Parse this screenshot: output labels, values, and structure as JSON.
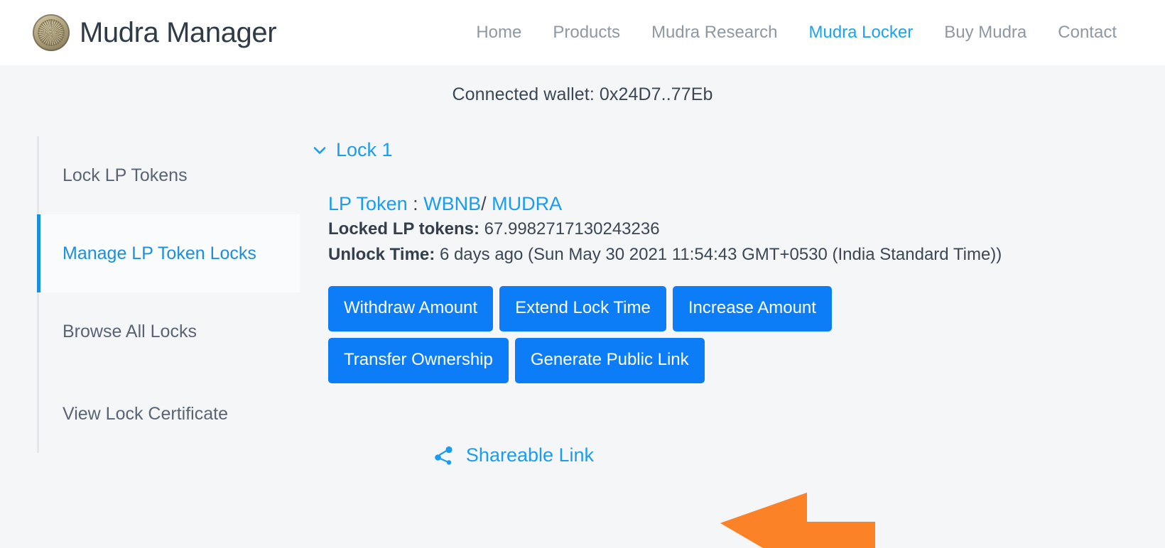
{
  "header": {
    "brand": {
      "logo_icon": "mudra-coin-icon",
      "title": "Mudra Manager"
    },
    "nav": [
      {
        "label": "Home",
        "active": false
      },
      {
        "label": "Products",
        "active": false
      },
      {
        "label": "Mudra Research",
        "active": false
      },
      {
        "label": "Mudra Locker",
        "active": true
      },
      {
        "label": "Buy Mudra",
        "active": false
      },
      {
        "label": "Contact",
        "active": false
      }
    ]
  },
  "wallet": {
    "text": "Connected wallet: 0x24D7..77Eb"
  },
  "sidebar": {
    "items": [
      {
        "label": "Lock LP Tokens",
        "active": false
      },
      {
        "label": "Manage LP Token Locks",
        "active": true
      },
      {
        "label": "Browse All Locks",
        "active": false
      },
      {
        "label": "View Lock Certificate",
        "active": false
      }
    ]
  },
  "lock": {
    "toggle_icon": "chevron-down-icon",
    "toggle_label": "Lock 1",
    "lp_token_label": "LP Token",
    "lp_token_colon": " : ",
    "lp_token_a": "WBNB",
    "lp_token_separator": "/ ",
    "lp_token_b": "MUDRA",
    "locked_label": "Locked LP tokens:",
    "locked_value": "67.9982717130243236",
    "unlock_label": "Unlock Time:",
    "unlock_value": "6 days ago (Sun May 30 2021 11:54:43 GMT+0530 (India Standard Time))",
    "actions_row_1": [
      "Withdraw Amount",
      "Extend Lock Time",
      "Increase Amount"
    ],
    "actions_row_2": [
      "Transfer Ownership",
      "Generate Public Link"
    ],
    "share": {
      "icon": "share-nodes-icon",
      "label": "Shareable Link"
    }
  },
  "annotation": {
    "arrow_icon": "left-pointing-arrow-icon",
    "arrow_color": "#FB8227",
    "points_to": "Shareable Link"
  },
  "colors": {
    "page_background": "#f5f6f8",
    "header_background": "#ffffff",
    "accent_blue": "#1a9cf0",
    "button_blue": "#0d7cf7",
    "nav_inactive": "#8d98a4",
    "text_dark": "#3c4753",
    "annotation_orange": "#FB8227"
  }
}
